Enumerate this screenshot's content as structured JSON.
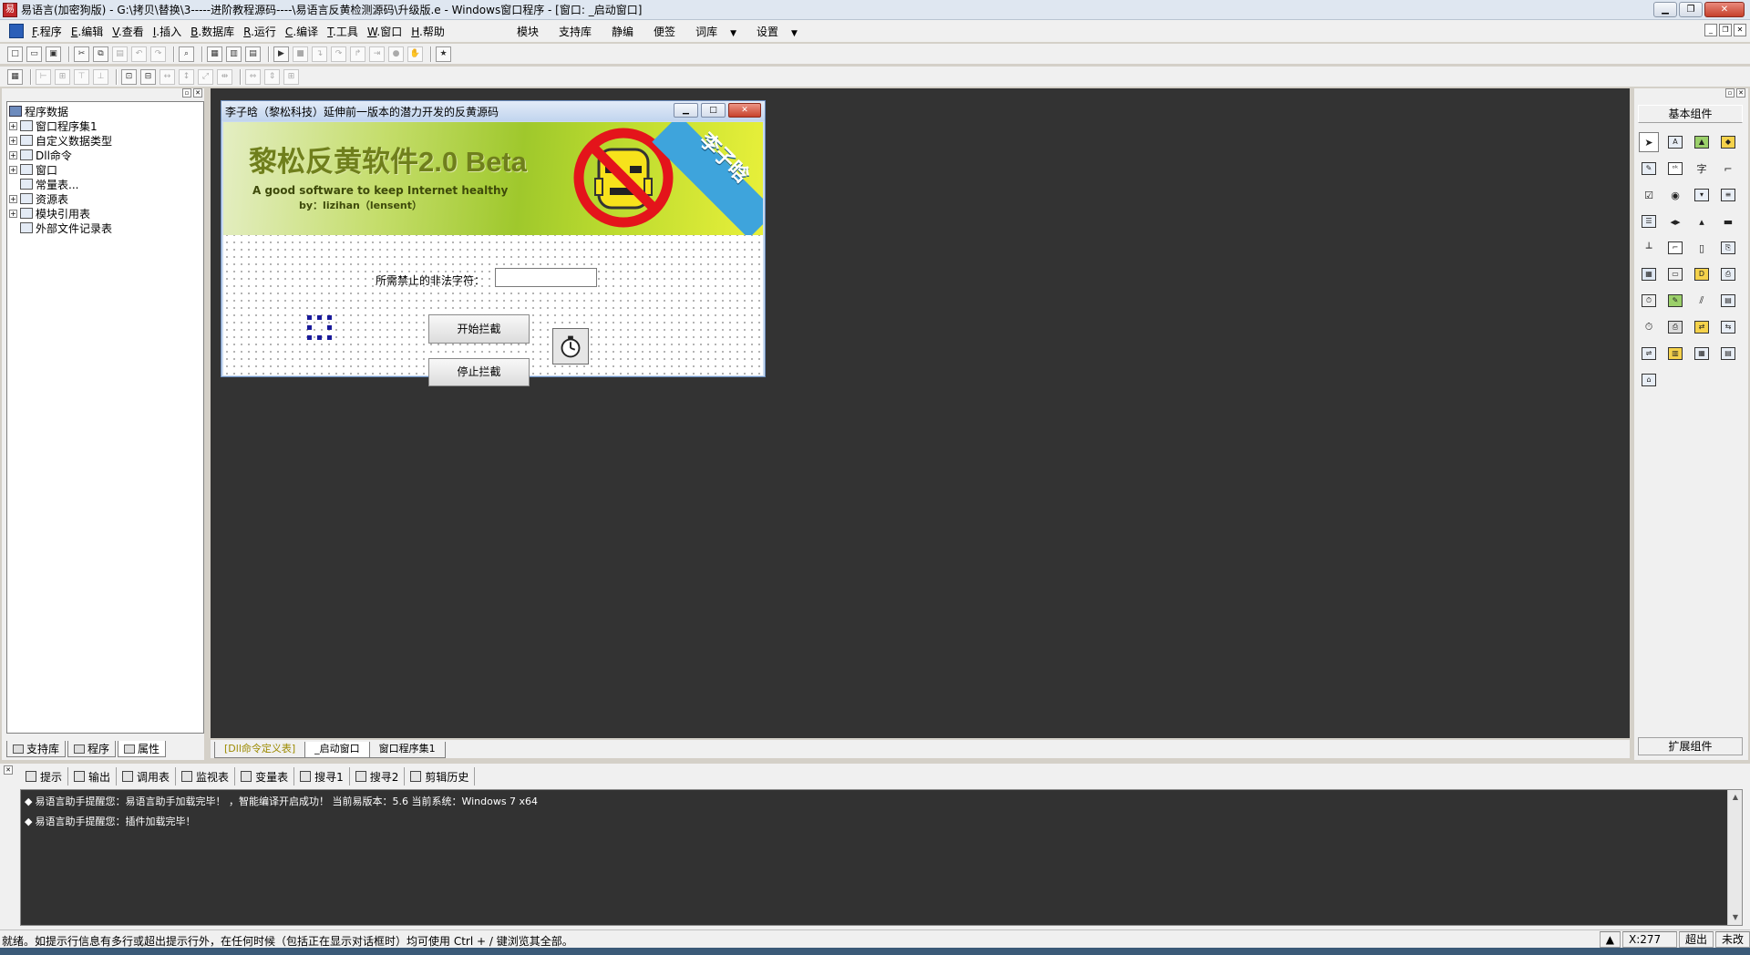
{
  "window": {
    "title": "易语言(加密狗版) - G:\\拷贝\\替换\\3-----进阶教程源码----\\易语言反黄检测源码\\升级版.e - Windows窗口程序 - [窗口: _启动窗口]",
    "app_icon_glyph": "易"
  },
  "menubar": {
    "items": [
      {
        "key": "F",
        "label": ".程序"
      },
      {
        "key": "E",
        "label": ".编辑"
      },
      {
        "key": "V",
        "label": ".查看"
      },
      {
        "key": "I",
        "label": ".插入"
      },
      {
        "key": "B",
        "label": ".数据库"
      },
      {
        "key": "R",
        "label": ".运行"
      },
      {
        "key": "C",
        "label": ".编译"
      },
      {
        "key": "T",
        "label": ".工具"
      },
      {
        "key": "W",
        "label": ".窗口"
      },
      {
        "key": "H",
        "label": ".帮助"
      }
    ],
    "right_items": [
      "模块",
      "支持库",
      "静编",
      "便签",
      "词库",
      "设置"
    ]
  },
  "left_panel": {
    "tree": {
      "root": "程序数据",
      "items": [
        {
          "label": "窗口程序集1",
          "expandable": true
        },
        {
          "label": "自定义数据类型",
          "expandable": true
        },
        {
          "label": "Dll命令",
          "expandable": true
        },
        {
          "label": "窗口",
          "expandable": true
        },
        {
          "label": "常量表...",
          "expandable": false
        },
        {
          "label": "资源表",
          "expandable": true
        },
        {
          "label": "模块引用表",
          "expandable": true
        },
        {
          "label": "外部文件记录表",
          "expandable": false
        }
      ]
    },
    "tabs": [
      "支持库",
      "程序",
      "属性"
    ]
  },
  "doc_tabs": [
    "[Dll命令定义表]",
    "_启动窗口",
    "窗口程序集1"
  ],
  "form": {
    "caption": "李子晗（黎松科技）延伸前一版本的潜力开发的反黄源码",
    "banner_title": "黎松反黄软件2.0 Beta",
    "banner_subtitle_1": "A good software to keep Internet healthy",
    "banner_subtitle_2": "by：lizihan（lensent）",
    "banner_ribbon": "李子晗",
    "label_illegal": "所需禁止的非法字符：",
    "input_illegal_value": "",
    "btn_start": "开始拦截",
    "btn_stop": "停止拦截"
  },
  "right_panel": {
    "basic_title": "基本组件",
    "ext_title": "扩展组件",
    "palette": [
      "pointer-icon",
      "label-icon",
      "picture-icon",
      "shape-icon",
      "edit-icon",
      "groupbox-icon",
      "text-char-icon",
      "line-icon",
      "checkbox-icon",
      "radio-icon",
      "combobox-icon",
      "listbox-icon",
      "list-icon",
      "hscroll-icon",
      "vscroll-icon",
      "progress-icon",
      "slider-icon",
      "tab-icon",
      "drive-icon",
      "file-icon",
      "color-icon",
      "font-icon",
      "calendar-icon",
      "treeview-icon",
      "timer-icon",
      "printer-icon",
      "network-icon",
      "client-icon",
      "server-icon",
      "port-icon",
      "table-icon",
      "toolbar-icon",
      "data-icon",
      "db-icon",
      "chart-icon",
      "odbc-icon",
      "odbc-link-icon"
    ]
  },
  "output": {
    "tabs": [
      "提示",
      "输出",
      "调用表",
      "监视表",
      "变量表",
      "搜寻1",
      "搜寻2",
      "剪辑历史"
    ],
    "lines": [
      "易语言助手提醒您：易语言助手加载完毕！  ，智能编译开启成功！  当前易版本：5.6  当前系统：Windows 7 x64",
      "易语言助手提醒您：插件加载完毕！"
    ]
  },
  "statusbar": {
    "text": "就绪。如提示行信息有多行或超出提示行外，在任何时候（包括正在显示对话框时）均可使用 Ctrl + / 键浏览其全部。",
    "coord": "X:277",
    "mode": "超出",
    "save_state": "未改"
  },
  "colors": {
    "design_background": "#333333",
    "output_background": "#323232",
    "ribbon": "#3ea4dc",
    "no_sign": "#e4141b"
  }
}
